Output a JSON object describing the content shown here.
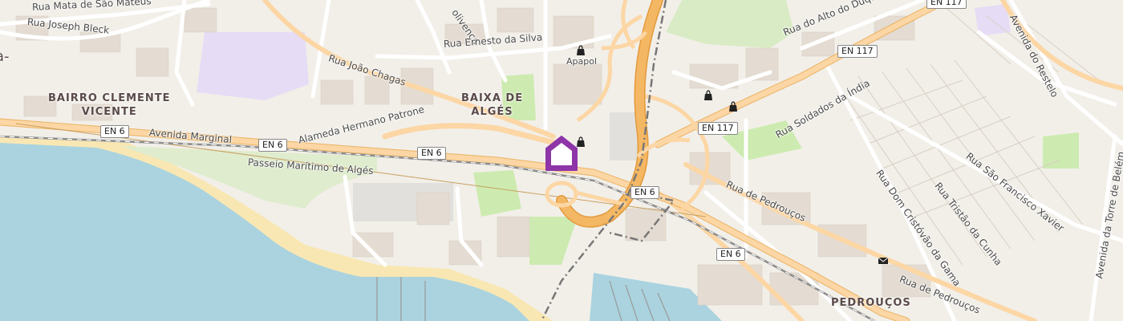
{
  "colors": {
    "land": "#f2efe9",
    "water": "#aad3df",
    "motorway": "#f4b763",
    "primary": "#fcd6a4",
    "park": "#cdebb0",
    "beach": "#f9e7b3",
    "marker": "#8e35a8"
  },
  "areas": {
    "bairro": "BAIRRO CLEMENTE\nVICENTE",
    "baixa": "BAIXA DE\nALGÉS",
    "pedroucos": "PEDROUÇOS",
    "edge_fragment": "a-"
  },
  "streets": {
    "mata": "Rua Mata de São Mateus",
    "joseph_bleck": "Rua Joseph Bleck",
    "convenca": "olivença",
    "ernesto": "Rua Ernesto da Silva",
    "joao_chagas": "Rua João Chagas",
    "hermano_patrone": "Alameda Hermano Patrone",
    "avenida_marginal": "Avenida Marginal",
    "passeio": "Passeio Marítimo de Algés",
    "alto_duque": "Rua do Alto do Duque",
    "avenida_restelo": "Avenida do Restelo",
    "soldados_india": "Rua Soldados da Índia",
    "sao_francisco": "Rua São Francisco Xavier",
    "tristao": "Rua Tristão da Cunha",
    "dom_cristovao": "Rua Dom Cristóvão da Gama",
    "pedroucos_1": "Rua de Pedrouços",
    "pedroucos_2": "Rua de Pedrouços",
    "torre_belem": "Avenida da Torre de Belém"
  },
  "shields": {
    "en6_a": "EN 6",
    "en6_b": "EN 6",
    "en6_c": "EN 6",
    "en6_d": "EN 6",
    "en6_e": "EN 6",
    "en117_a": "EN 117",
    "en117_b": "EN 117",
    "en117_c": "EN 117"
  },
  "pois": {
    "apapol": "Apapol"
  },
  "icons": {
    "shop": "shopping-bag-icon",
    "post": "post-office-icon",
    "marker": "location-marker-icon"
  }
}
